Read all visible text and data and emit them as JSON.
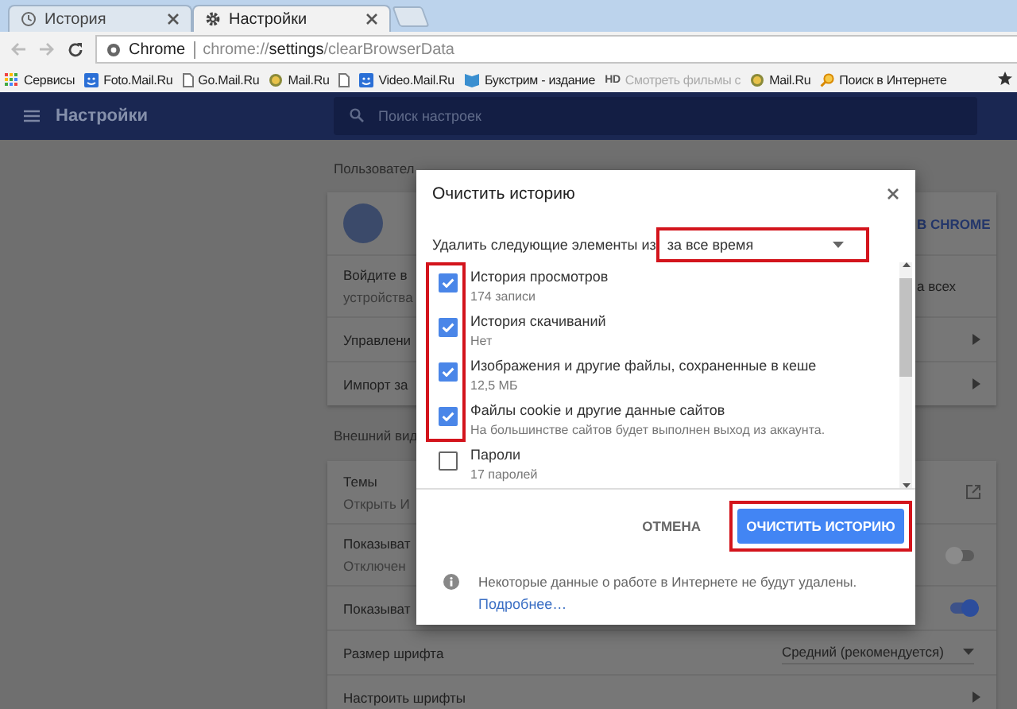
{
  "tabs": [
    {
      "label": "История",
      "kind": "history",
      "selected": false
    },
    {
      "label": "Настройки",
      "kind": "settings",
      "selected": true
    }
  ],
  "toolbar": {
    "site_label": "Chrome",
    "url": {
      "scheme": "chrome://",
      "host": "settings",
      "path": "/clearBrowserData"
    }
  },
  "bookmarks": [
    {
      "label": "Сервисы",
      "kind": "apps"
    },
    {
      "label": "Foto.Mail.Ru",
      "kind": "mail"
    },
    {
      "label": "Go.Mail.Ru",
      "kind": "page"
    },
    {
      "label": "Mail.Ru",
      "kind": "globe"
    },
    {
      "kind": "page"
    },
    {
      "label": "Video.Mail.Ru",
      "kind": "mail"
    },
    {
      "label": "Букстрим - издание",
      "kind": "book"
    },
    {
      "label": "Смотреть фильмы с",
      "kind": "hd",
      "badge": "HD"
    },
    {
      "label": "Mail.Ru",
      "kind": "globe"
    },
    {
      "label": "Поиск в Интернете",
      "kind": "search"
    }
  ],
  "header": {
    "title": "Настройки",
    "search_placeholder": "Поиск настроек"
  },
  "settings": {
    "sections": [
      {
        "heading": "Пользовател",
        "rows": [
          {
            "kind": "avatar",
            "right": "В CHROME"
          },
          {
            "kind": "text",
            "lines": [
              "Войдите в",
              "устройства"
            ],
            "right": "а всех"
          },
          {
            "kind": "arrow",
            "lines": [
              "Управлени"
            ]
          },
          {
            "kind": "arrow",
            "lines": [
              "Импорт за"
            ]
          }
        ]
      },
      {
        "heading": "Внешний вид",
        "rows": [
          {
            "kind": "external",
            "lines": [
              "Темы",
              "Открыть И"
            ]
          },
          {
            "kind": "toggle",
            "lines": [
              "Показыват",
              "Отключен"
            ],
            "on": false
          },
          {
            "kind": "toggle",
            "lines": [
              "Показыват"
            ],
            "on": true
          },
          {
            "kind": "select",
            "lines": [
              "Размер шрифта"
            ],
            "value": "Средний (рекомендуется)"
          },
          {
            "kind": "arrow",
            "lines": [
              "Настроить шрифты"
            ]
          }
        ]
      }
    ]
  },
  "dialog": {
    "title": "Очистить историю",
    "range_label": "Удалить следующие элементы из",
    "range": {
      "value": "за все время",
      "highlighted": true
    },
    "items_highlighted": true,
    "items": [
      {
        "label": "История просмотров",
        "detail": "174 записи",
        "checked": true
      },
      {
        "label": "История скачиваний",
        "detail": "Нет",
        "checked": true
      },
      {
        "label": "Изображения и другие файлы, сохраненные в кеше",
        "detail": "12,5 МБ",
        "checked": true
      },
      {
        "label": "Файлы cookie и другие данные сайтов",
        "detail": "На большинстве сайтов будет выполнен выход из аккаунта.",
        "checked": true
      },
      {
        "label": "Пароли",
        "detail": "17 паролей",
        "checked": false
      }
    ],
    "cancel": "ОТМЕНА",
    "confirm": {
      "label": "ОЧИСТИТЬ ИСТОРИЮ",
      "highlighted": true
    },
    "note": "Некоторые данные о работе в Интернете не будут удалены.",
    "link": "Подробнее…"
  }
}
